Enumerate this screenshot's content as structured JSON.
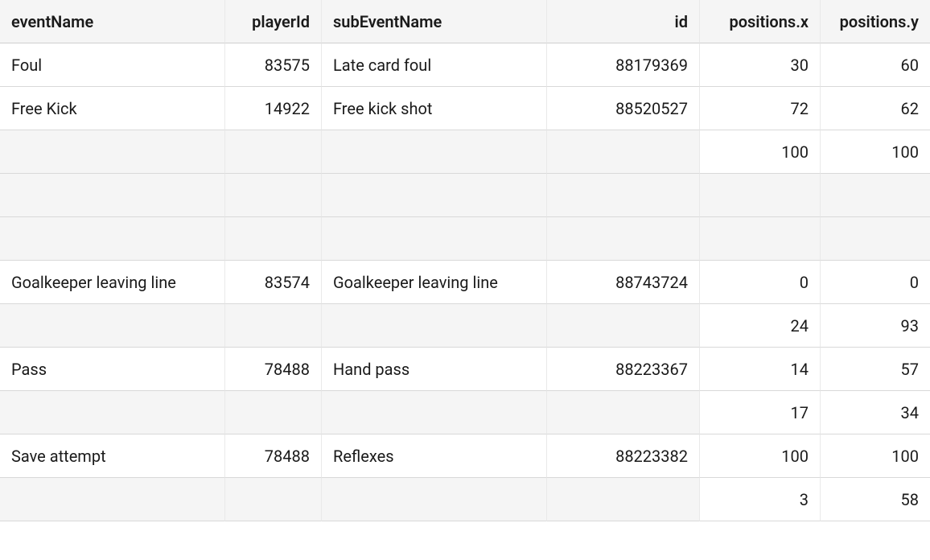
{
  "columns": {
    "eventName": "eventName",
    "playerId": "playerId",
    "subEventName": "subEventName",
    "id": "id",
    "positionsX": "positions.x",
    "positionsY": "positions.y"
  },
  "rows": [
    {
      "eventName": "Foul",
      "playerId": "83575",
      "subEventName": "Late card foul",
      "id": "88179369",
      "posX": "30",
      "posY": "60",
      "shaded": false
    },
    {
      "eventName": "Free Kick",
      "playerId": "14922",
      "subEventName": "Free kick shot",
      "id": "88520527",
      "posX": "72",
      "posY": "62",
      "shaded": false
    },
    {
      "eventName": "",
      "playerId": "",
      "subEventName": "",
      "id": "",
      "posX": "100",
      "posY": "100",
      "shaded": true
    },
    {
      "eventName": "",
      "playerId": "",
      "subEventName": "",
      "id": "",
      "posX": "",
      "posY": "",
      "shaded": true
    },
    {
      "eventName": "",
      "playerId": "",
      "subEventName": "",
      "id": "",
      "posX": "",
      "posY": "",
      "shaded": true
    },
    {
      "eventName": "Goalkeeper leaving line",
      "playerId": "83574",
      "subEventName": "Goalkeeper leaving line",
      "id": "88743724",
      "posX": "0",
      "posY": "0",
      "shaded": false
    },
    {
      "eventName": "",
      "playerId": "",
      "subEventName": "",
      "id": "",
      "posX": "24",
      "posY": "93",
      "shaded": true
    },
    {
      "eventName": "Pass",
      "playerId": "78488",
      "subEventName": "Hand pass",
      "id": "88223367",
      "posX": "14",
      "posY": "57",
      "shaded": false
    },
    {
      "eventName": "",
      "playerId": "",
      "subEventName": "",
      "id": "",
      "posX": "17",
      "posY": "34",
      "shaded": true
    },
    {
      "eventName": "Save attempt",
      "playerId": "78488",
      "subEventName": "Reflexes",
      "id": "88223382",
      "posX": "100",
      "posY": "100",
      "shaded": false
    },
    {
      "eventName": "",
      "playerId": "",
      "subEventName": "",
      "id": "",
      "posX": "3",
      "posY": "58",
      "shaded": true
    }
  ]
}
